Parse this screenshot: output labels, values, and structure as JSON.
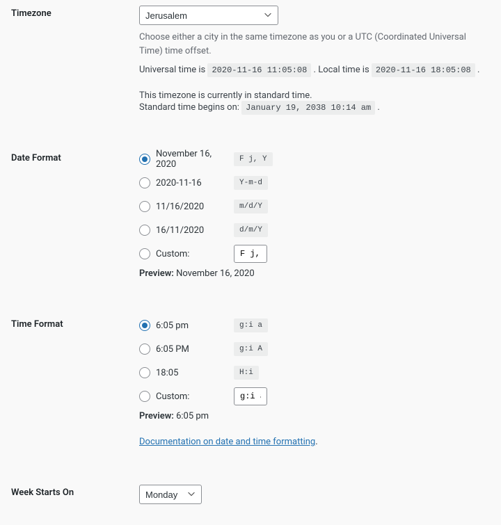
{
  "timezone": {
    "label": "Timezone",
    "value": "Jerusalem",
    "help": "Choose either a city in the same timezone as you or a UTC (Coordinated Universal Time) time offset.",
    "utc_prefix": "Universal time is ",
    "utc_value": "2020-11-16 11:05:08",
    "local_prefix": " . Local time is ",
    "local_value": "2020-11-16 18:05:08",
    "trailing": " .",
    "standard_current": "This timezone is currently in standard time.",
    "standard_begins_prefix": "Standard time begins on: ",
    "standard_begins_value": "January 19, 2038 10:14 am",
    "standard_begins_suffix": " ."
  },
  "date_format": {
    "label": "Date Format",
    "options": [
      {
        "display": "November 16, 2020",
        "code": "F j, Y",
        "checked": true
      },
      {
        "display": "2020-11-16",
        "code": "Y-m-d",
        "checked": false
      },
      {
        "display": "11/16/2020",
        "code": "m/d/Y",
        "checked": false
      },
      {
        "display": "16/11/2020",
        "code": "d/m/Y",
        "checked": false
      }
    ],
    "custom_label": "Custom:",
    "custom_value": "F j, Y",
    "preview_label": "Preview:",
    "preview_value": "November 16, 2020"
  },
  "time_format": {
    "label": "Time Format",
    "options": [
      {
        "display": "6:05 pm",
        "code": "g:i a",
        "checked": true
      },
      {
        "display": "6:05 PM",
        "code": "g:i A",
        "checked": false
      },
      {
        "display": "18:05",
        "code": "H:i",
        "checked": false
      }
    ],
    "custom_label": "Custom:",
    "custom_value": "g:i a",
    "preview_label": "Preview:",
    "preview_value": "6:05 pm",
    "doc_link": "Documentation on date and time formatting",
    "doc_suffix": "."
  },
  "week": {
    "label": "Week Starts On",
    "value": "Monday"
  }
}
